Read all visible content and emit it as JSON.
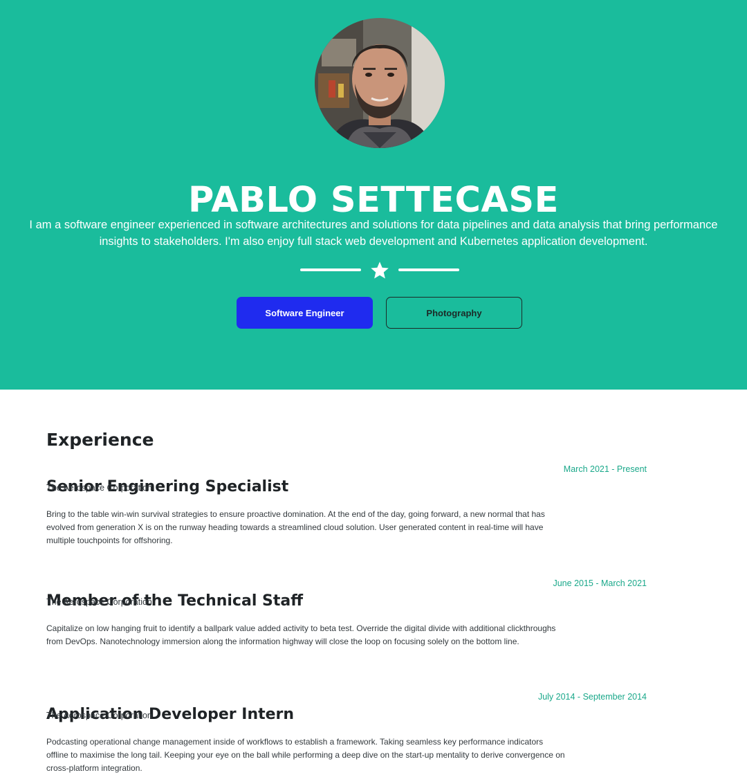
{
  "profile": {
    "name": "PABLO SETTECASE",
    "bio": "I am a software engineer experienced in software architectures and solutions for data pipelines and data analysis that bring performance insights to stakeholders. I'm also enjoy full stack web development and Kubernetes application development."
  },
  "buttons": {
    "primary_label": "Software Engineer",
    "secondary_label": "Photography"
  },
  "experience": {
    "title": "Experience",
    "jobs": [
      {
        "title": "Senior Enginering Specialist",
        "company": "The Aerospace Corporation",
        "dates": "March 2021 - Present",
        "description": "Bring to the table win-win survival strategies to ensure proactive domination. At the end of the day, going forward, a new normal that has evolved from generation X is on the runway heading towards a streamlined cloud solution. User generated content in real-time will have multiple touchpoints for offshoring."
      },
      {
        "title": "Member of the Technical Staff",
        "company": "The Aerospace Corporation",
        "dates": "June 2015 - March 2021",
        "description": "Capitalize on low hanging fruit to identify a ballpark value added activity to beta test. Override the digital divide with additional clickthroughs from DevOps. Nanotechnology immersion along the information highway will close the loop on focusing solely on the bottom line."
      },
      {
        "title": "Application Developer Intern",
        "company": "The Aerospace Corporation",
        "dates": "July 2014 - September 2014",
        "description": "Podcasting operational change management inside of workflows to establish a framework. Taking seamless key performance indicators offline to maximise the long tail. Keeping your eye on the ball while performing a deep dive on the start-up mentality to derive convergence on cross-platform integration."
      }
    ]
  },
  "icons": {
    "avatar": "profile-photo",
    "divider": "star-icon"
  },
  "colors": {
    "hero_bg": "#1abc9c",
    "primary_button": "#1f2bef",
    "date_accent": "#1aa88a",
    "text_dark": "#1f2326"
  }
}
